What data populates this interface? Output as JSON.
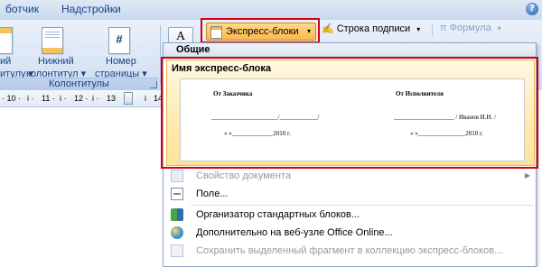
{
  "tabs": {
    "developer_partial": "ботчик",
    "addins": "Надстройки"
  },
  "help": {
    "glyph": "?"
  },
  "header_footer_group": {
    "partial_left_line1": "ий",
    "partial_left_line2": "итулу ▾",
    "footer_line1": "Нижний",
    "footer_line2": "колонтитул ▾",
    "pagenum_line1": "Номер",
    "pagenum_line2": "страницы ▾",
    "pagenum_glyph": "#",
    "title": "Колонтитулы"
  },
  "insert_toolbar": {
    "textbox_glyph": "A",
    "quick_parts_label": "Экспресс-блоки",
    "quick_parts_arrow": "▾",
    "signature_label": "Строка подписи",
    "signature_arrow": "▾",
    "formula_label": "π Формула",
    "formula_arrow": "▾"
  },
  "ruler": {
    "marks": [
      "· 10 ·",
      "i ·",
      "11 ·",
      "i ·",
      "12 ·",
      "i ·",
      "13",
      "i",
      "14"
    ]
  },
  "dropdown": {
    "section_title": "Общие",
    "gallery_item_title": "Имя экспресс-блока",
    "preview": {
      "left_heading": "От Заказчика",
      "right_heading": "От Исполнителя",
      "left_sign_line": "_____________________/____________/",
      "right_sign_line": "___________________ / Иванов И.И. /",
      "left_date_line": "«    »_____________2010 г.",
      "right_date_line": "«    »_______________2010 г."
    },
    "menu": [
      {
        "label": "Свойство документа",
        "enabled": false,
        "has_submenu": true,
        "submenu_glyph": "▶"
      },
      {
        "label": "Поле...",
        "enabled": true
      },
      {
        "label": "Организатор стандартных блоков...",
        "enabled": true
      },
      {
        "label": "Дополнительно на веб-узле Office Online...",
        "enabled": true
      },
      {
        "label": "Сохранить выделенный фрагмент в коллекцию экспресс-блоков...",
        "enabled": false
      }
    ]
  }
}
